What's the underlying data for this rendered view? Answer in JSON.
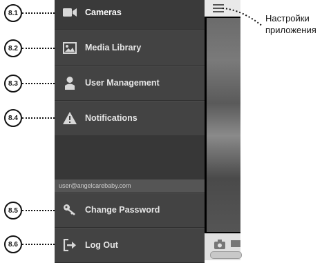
{
  "menu": {
    "items": [
      {
        "label": "Cameras",
        "icon": "video-camera-icon",
        "callout": "8.1"
      },
      {
        "label": "Media Library",
        "icon": "image-icon",
        "callout": "8.2"
      },
      {
        "label": "User Management",
        "icon": "user-icon",
        "callout": "8.3"
      },
      {
        "label": "Notifications",
        "icon": "warning-icon",
        "callout": "8.4"
      }
    ],
    "account_email": "user@angelcarebaby.com",
    "bottom_items": [
      {
        "label": "Change Password",
        "icon": "key-icon",
        "callout": "8.5"
      },
      {
        "label": "Log Out",
        "icon": "logout-icon",
        "callout": "8.6"
      }
    ]
  },
  "annotation": {
    "line1": "Настройки",
    "line2": "приложения"
  },
  "colors": {
    "menu_bg": "#434343",
    "menu_text": "#e6e6e6",
    "badge_border": "#111111"
  }
}
